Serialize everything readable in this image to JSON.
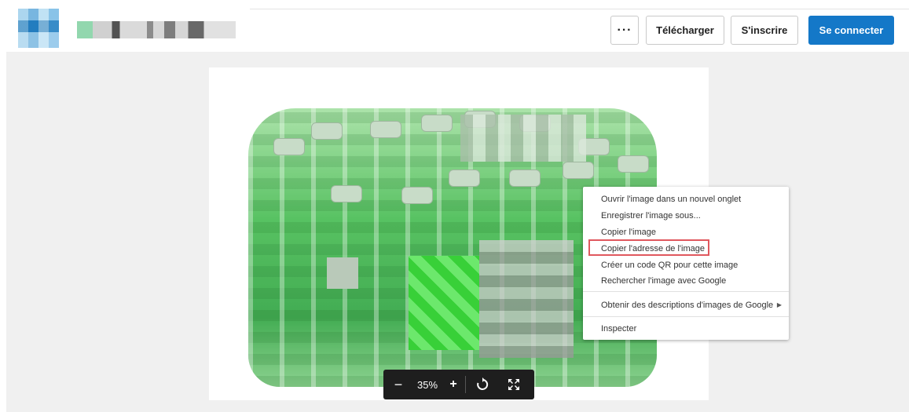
{
  "header": {
    "more_label": "···",
    "download_label": "Télécharger",
    "signup_label": "S'inscrire",
    "login_label": "Se connecter",
    "login_color": "#1478c8"
  },
  "zoom": {
    "minus": "−",
    "value": "35%",
    "plus": "+",
    "rotate_icon": "rotate-icon",
    "fullscreen_icon": "fullscreen-icon"
  },
  "context_menu": {
    "items": [
      "Ouvrir l'image dans un nouvel onglet",
      "Enregistrer l'image sous...",
      "Copier l'image",
      "Copier l'adresse de l'image",
      "Créer un code QR pour cette image",
      "Rechercher l'image avec Google",
      "Obtenir des descriptions d'images de Google",
      "Inspecter"
    ],
    "highlighted_index": 3,
    "highlight_color": "#e0585e",
    "submenu_arrow": "▶"
  }
}
